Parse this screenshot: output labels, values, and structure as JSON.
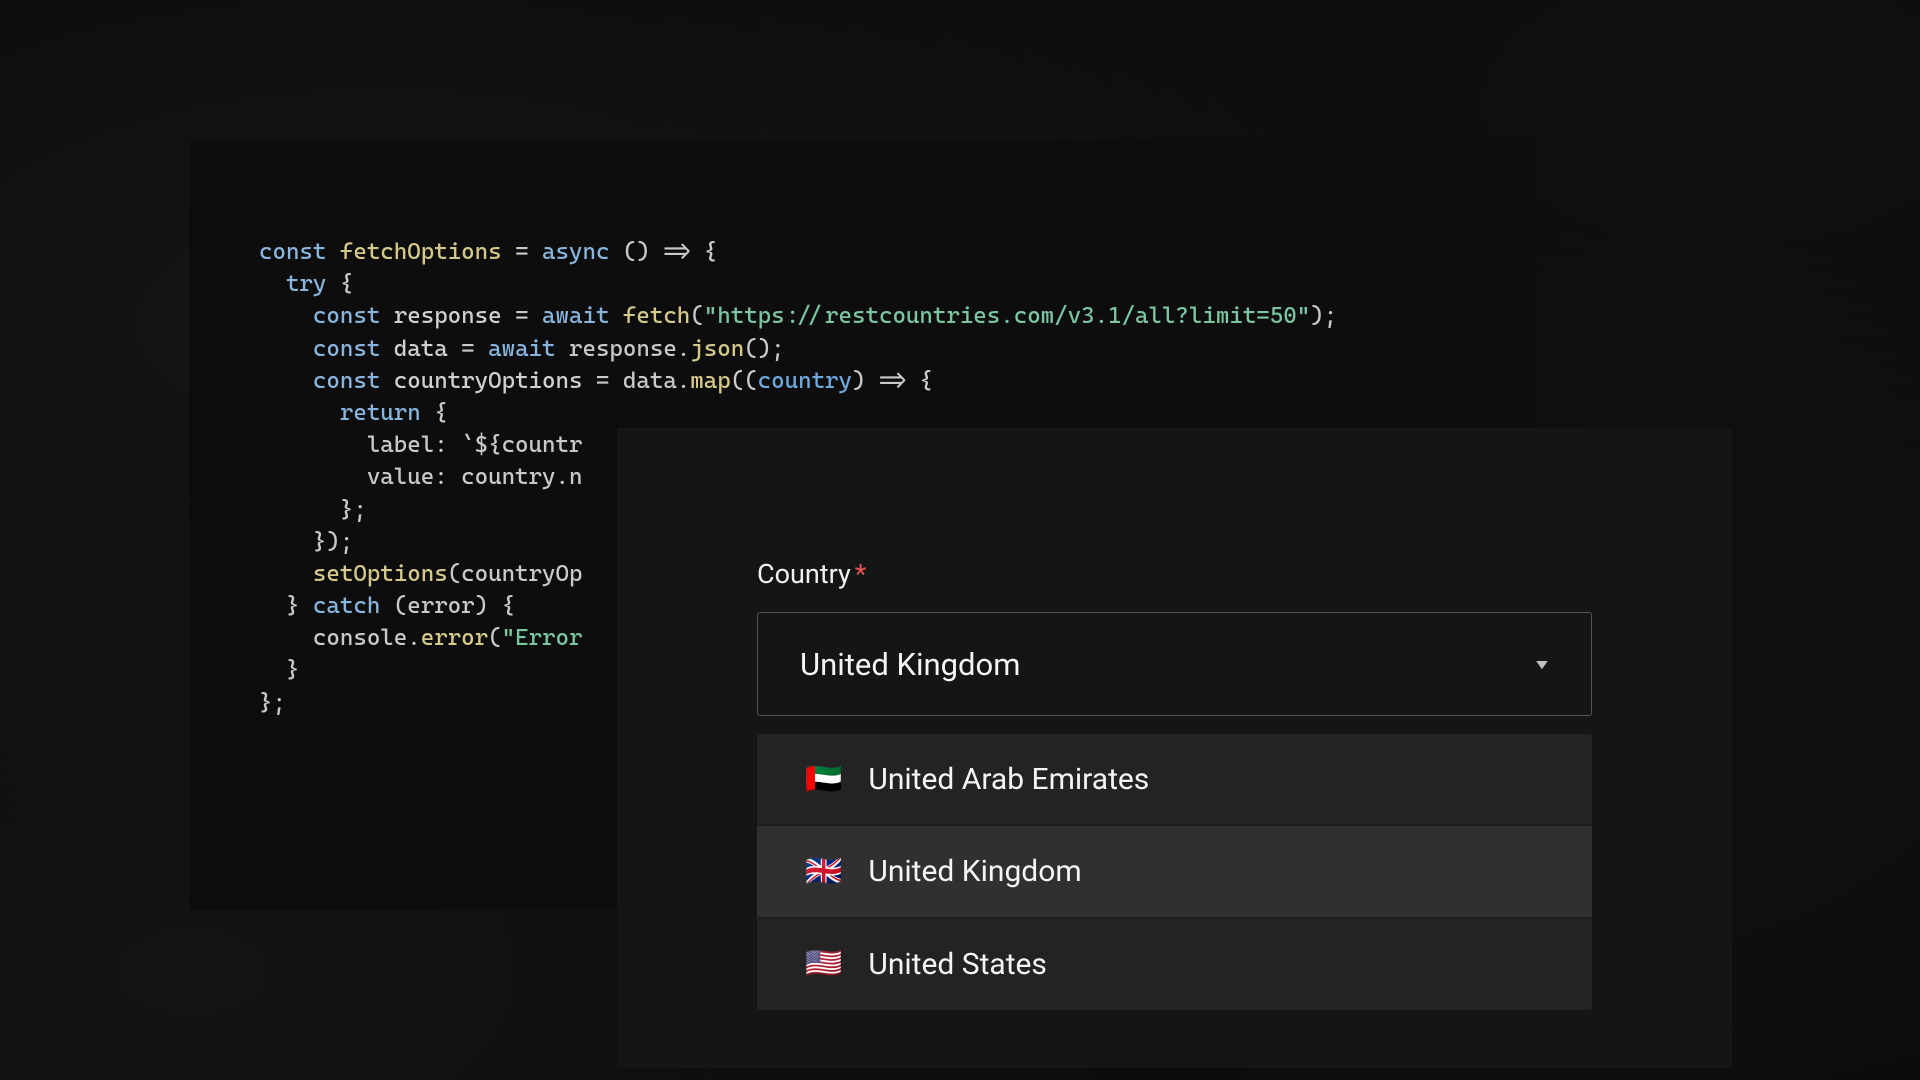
{
  "code": {
    "line1_kw1": "const",
    "line1_fn": " fetchOptions",
    "line1_eq": " = ",
    "line1_kw2": "async",
    "line1_rest": " () => {",
    "line2": "  try {",
    "line3_indent": "    ",
    "line3_kw": "const",
    "line3_var": " response",
    "line3_eq": " = ",
    "line3_kw2": "await",
    "line3_fn": " fetch",
    "line3_paren1": "(",
    "line3_str": "\"https://restcountries.com/v3.1/all?limit=50\"",
    "line3_paren2": ");",
    "line4_indent": "    ",
    "line4_kw": "const",
    "line4_var": " data",
    "line4_eq": " = ",
    "line4_kw2": "await",
    "line4_rest": " response.",
    "line4_fn": "json",
    "line4_end": "();",
    "line5": "",
    "line6_indent": "    ",
    "line6_kw": "const",
    "line6_var": " countryOptions",
    "line6_eq": " = data.",
    "line6_fn": "map",
    "line6_paren": "((",
    "line6_param": "country",
    "line6_rest": ") => {",
    "line7_indent": "      ",
    "line7_kw": "return",
    "line7_rest": " {",
    "line8": "        label: `${countr",
    "line9": "        value: country.n",
    "line10": "      };",
    "line11": "    });",
    "line12": "",
    "line13_indent": "    ",
    "line13_fn": "setOptions",
    "line13_rest": "(countryOp",
    "line14_indent": "  } ",
    "line14_kw": "catch",
    "line14_rest": " (error) {",
    "line15_indent": "    console.",
    "line15_fn": "error",
    "line15_paren": "(",
    "line15_str": "\"Error",
    "line16": "  }",
    "line17": "};"
  },
  "dropdown": {
    "label": "Country",
    "required_mark": "*",
    "selected_value": "United Kingdom",
    "options": [
      {
        "flag": "🇦🇪",
        "label": "United Arab Emirates"
      },
      {
        "flag": "🇬🇧",
        "label": "United Kingdom"
      },
      {
        "flag": "🇺🇸",
        "label": "United States"
      }
    ]
  }
}
